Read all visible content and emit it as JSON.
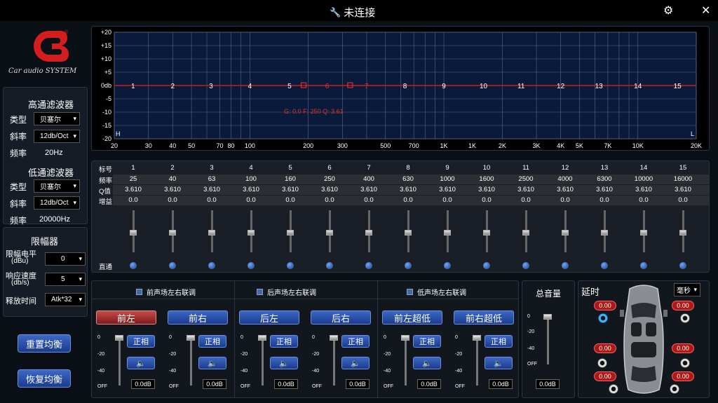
{
  "window": {
    "title": "未连接",
    "settings_icon": "gear-icon",
    "close_icon": "close-icon"
  },
  "logo": {
    "text": "Car audio SYSTEM",
    "reg": "®"
  },
  "highpass": {
    "title": "高通滤波器",
    "type_label": "类型",
    "type_value": "贝塞尔",
    "slope_label": "斜率",
    "slope_value": "12db/Oct",
    "freq_label": "频率",
    "freq_value": "20Hz"
  },
  "lowpass": {
    "title": "低通滤波器",
    "type_label": "类型",
    "type_value": "贝塞尔",
    "slope_label": "斜率",
    "slope_value": "12db/Oct",
    "freq_label": "频率",
    "freq_value": "20000Hz"
  },
  "limiter": {
    "title": "限幅器",
    "level_label": "限幅电平",
    "level_unit": "(dBu)",
    "level_value": "0",
    "speed_label": "响应速度",
    "speed_unit": "(db/s)",
    "speed_value": "5",
    "release_label": "释放时间",
    "release_value": "Atk*32"
  },
  "buttons": {
    "reset_eq": "重置均衡",
    "restore_eq": "恢复均衡"
  },
  "graph": {
    "y_ticks": [
      "+20",
      "+15",
      "+10",
      "+5",
      "0db",
      "-5",
      "-10",
      "-15",
      "-20"
    ],
    "x_ticks": [
      "20",
      "30",
      "40",
      "50",
      "70",
      "80",
      "100",
      "200",
      "300",
      "500",
      "700",
      "1K",
      "1K",
      "2K",
      "3K",
      "4K",
      "5K",
      "7K",
      "10K",
      "20K"
    ],
    "h_label": "H",
    "l_label": "L",
    "band_markers": [
      "1",
      "2",
      "3",
      "4",
      "5",
      "6",
      "7",
      "8",
      "9",
      "10",
      "11",
      "12",
      "13",
      "14",
      "15"
    ],
    "readout": "G: 0.0  F: 250  Q: 3.61",
    "curve_color": "#d01a1a"
  },
  "eq": {
    "row_labels": {
      "index": "标号",
      "freq": "频率",
      "q": "Q值",
      "gain": "增益",
      "bypass": "直通"
    },
    "bands": [
      {
        "index": "1",
        "freq": "25",
        "q": "3.610",
        "gain": "0.0"
      },
      {
        "index": "2",
        "freq": "40",
        "q": "3.610",
        "gain": "0.0"
      },
      {
        "index": "3",
        "freq": "63",
        "q": "3.610",
        "gain": "0.0"
      },
      {
        "index": "4",
        "freq": "100",
        "q": "3.610",
        "gain": "0.0"
      },
      {
        "index": "5",
        "freq": "160",
        "q": "3.610",
        "gain": "0.0"
      },
      {
        "index": "6",
        "freq": "250",
        "q": "3.610",
        "gain": "0.0"
      },
      {
        "index": "7",
        "freq": "400",
        "q": "3.610",
        "gain": "0.0"
      },
      {
        "index": "8",
        "freq": "630",
        "q": "3.610",
        "gain": "0.0"
      },
      {
        "index": "9",
        "freq": "1000",
        "q": "3.610",
        "gain": "0.0"
      },
      {
        "index": "10",
        "freq": "1600",
        "q": "3.610",
        "gain": "0.0"
      },
      {
        "index": "11",
        "freq": "2500",
        "q": "3.610",
        "gain": "0.0"
      },
      {
        "index": "12",
        "freq": "4000",
        "q": "3.610",
        "gain": "0.0"
      },
      {
        "index": "13",
        "freq": "6300",
        "q": "3.610",
        "gain": "0.0"
      },
      {
        "index": "14",
        "freq": "10000",
        "q": "3.610",
        "gain": "0.0"
      },
      {
        "index": "15",
        "freq": "16000",
        "q": "3.610",
        "gain": "0.0"
      }
    ]
  },
  "channels": {
    "links": [
      "前声场左右联调",
      "后声场左右联调",
      "低声场左右联调"
    ],
    "phase_label": "正相",
    "speaker_icon": "speaker-icon",
    "scale": [
      "0",
      "-20",
      "-40",
      "OFF"
    ],
    "list": [
      {
        "name": "前左",
        "gain": "0.0dB",
        "active": true
      },
      {
        "name": "前右",
        "gain": "0.0dB",
        "active": false
      },
      {
        "name": "后左",
        "gain": "0.0dB",
        "active": false
      },
      {
        "name": "后右",
        "gain": "0.0dB",
        "active": false
      },
      {
        "name": "前左超低",
        "gain": "0.0dB",
        "active": false
      },
      {
        "name": "前右超低",
        "gain": "0.0dB",
        "active": false
      }
    ],
    "master": {
      "title": "总音量",
      "gain": "0.0dB"
    }
  },
  "delay": {
    "title": "延时",
    "unit_value": "毫秒",
    "values": [
      "0.00",
      "0.00",
      "0.00",
      "0.00",
      "0.00",
      "0.00"
    ]
  }
}
